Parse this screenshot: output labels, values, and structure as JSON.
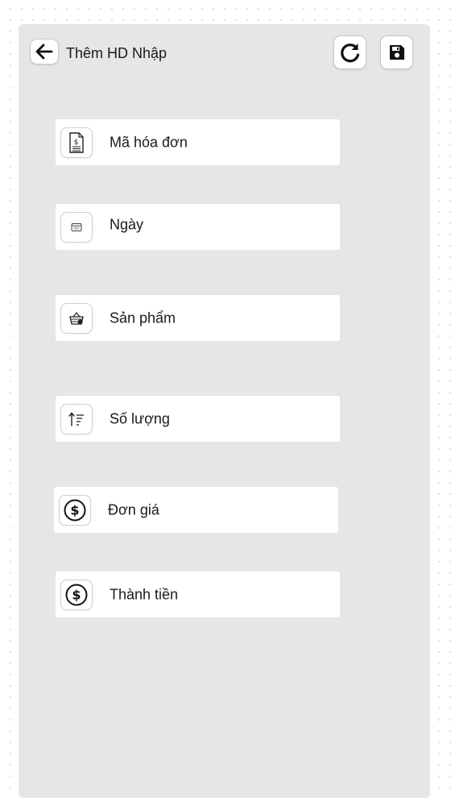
{
  "header": {
    "title": "Thêm HD Nhập",
    "back_icon": "arrow-left-icon",
    "refresh_icon": "refresh-icon",
    "save_icon": "floppy-disk-icon"
  },
  "form": {
    "fields": [
      {
        "label": "Mã hóa đơn",
        "icon": "invoice-document-icon"
      },
      {
        "label": "Ngày",
        "icon": "calendar-icon"
      },
      {
        "label": "Sản phẩm",
        "icon": "basket-icon"
      },
      {
        "label": "Số lượng",
        "icon": "sort-quantity-icon"
      },
      {
        "label": "Đơn giá",
        "icon": "dollar-circle-icon"
      },
      {
        "label": "Thành tiền",
        "icon": "dollar-circle-icon"
      }
    ]
  },
  "colors": {
    "panel_bg": "#e6e6e6",
    "field_bg": "#ffffff",
    "text": "#1a1a1a"
  }
}
